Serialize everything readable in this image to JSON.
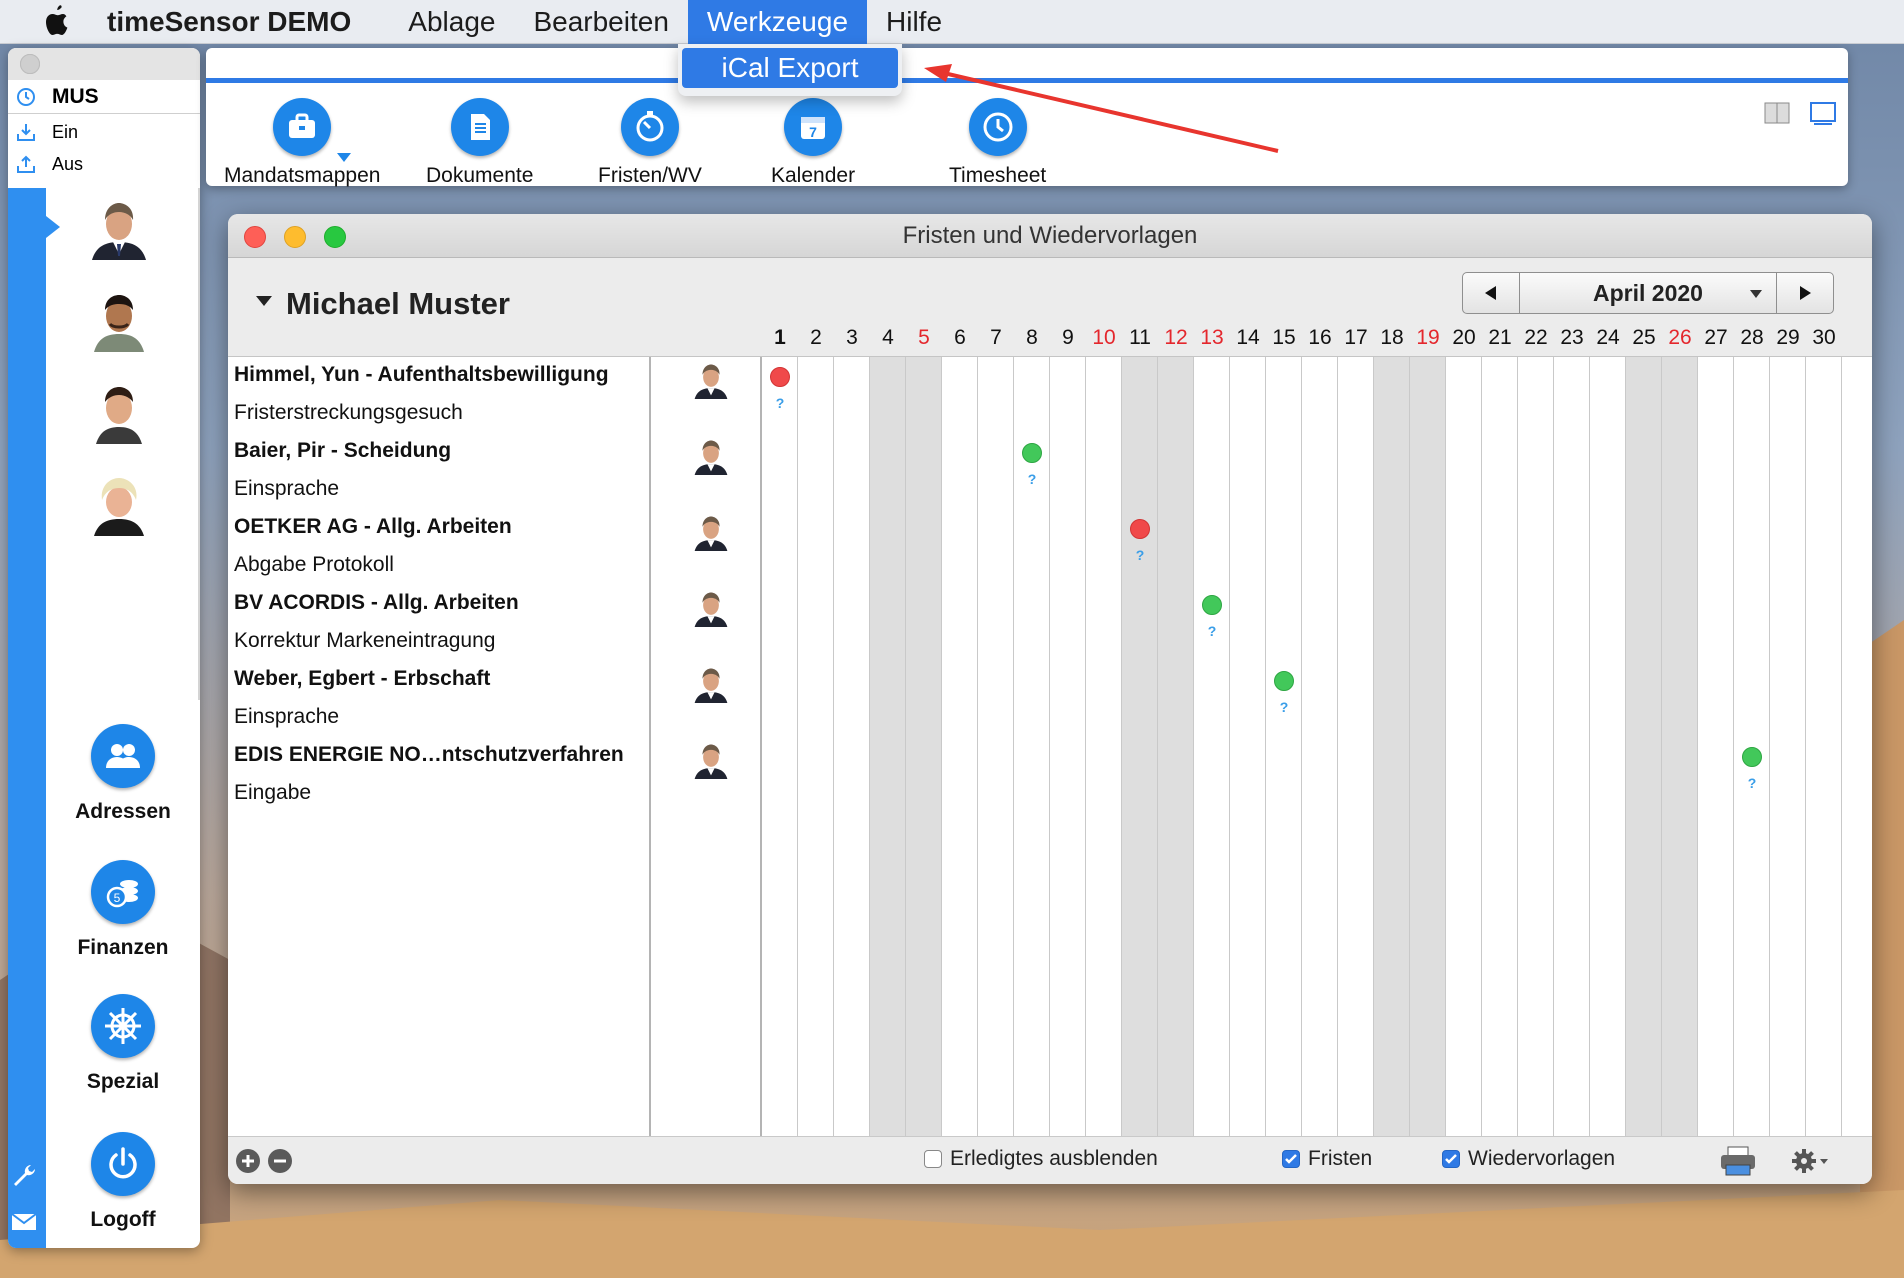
{
  "menubar": {
    "app_name": "timeSensor DEMO",
    "items": [
      "Ablage",
      "Bearbeiten",
      "Werkzeuge",
      "Hilfe"
    ],
    "active_item": "Werkzeuge",
    "dropdown_item": "iCal Export"
  },
  "palette": {
    "user_code": "MUS",
    "ein_label": "Ein",
    "aus_label": "Aus",
    "nav": [
      {
        "label": "Adressen",
        "icon": "people-icon"
      },
      {
        "label": "Finanzen",
        "icon": "coins-icon"
      },
      {
        "label": "Spezial",
        "icon": "helm-wheel-icon"
      },
      {
        "label": "Logoff",
        "icon": "power-icon"
      }
    ]
  },
  "toolbar": {
    "buttons": [
      {
        "label": "Mandatsmappen",
        "icon": "briefcase-icon"
      },
      {
        "label": "Dokumente",
        "icon": "document-icon"
      },
      {
        "label": "Fristen/WV",
        "icon": "stopwatch-icon"
      },
      {
        "label": "Kalender",
        "icon": "calendar-icon",
        "badge": "7"
      },
      {
        "label": "Timesheet",
        "icon": "clock-icon"
      }
    ]
  },
  "window": {
    "title": "Fristen und Wiedervorlagen",
    "person": "Michael Muster",
    "month": "April 2020",
    "days": [
      1,
      2,
      3,
      4,
      5,
      6,
      7,
      8,
      9,
      10,
      11,
      12,
      13,
      14,
      15,
      16,
      17,
      18,
      19,
      20,
      21,
      22,
      23,
      24,
      25,
      26,
      27,
      28,
      29,
      30
    ],
    "red_days": [
      5,
      10,
      12,
      13,
      19,
      26
    ],
    "weekend_days": [
      4,
      5,
      11,
      12,
      18,
      19,
      25,
      26
    ],
    "today": 1,
    "rows": [
      {
        "title": "Himmel, Yun - Aufenthaltsbewilligung",
        "subtitle": "Fristerstreckungsgesuch",
        "day": 1,
        "status": "red"
      },
      {
        "title": "Baier, Pir - Scheidung",
        "subtitle": "Einsprache",
        "day": 8,
        "status": "green"
      },
      {
        "title": "OETKER AG - Allg. Arbeiten",
        "subtitle": "Abgabe Protokoll",
        "day": 11,
        "status": "red"
      },
      {
        "title": "BV ACORDIS - Allg. Arbeiten",
        "subtitle": "Korrektur Markeneintragung",
        "day": 13,
        "status": "green"
      },
      {
        "title": "Weber, Egbert - Erbschaft",
        "subtitle": "Einsprache",
        "day": 15,
        "status": "green"
      },
      {
        "title": "EDIS ENERGIE NO…ntschutzverfahren",
        "subtitle": "Eingabe",
        "day": 28,
        "status": "green"
      }
    ],
    "qmark": "?",
    "footer": {
      "hide_done_label": "Erledigtes ausblenden",
      "hide_done_checked": false,
      "fristen_label": "Fristen",
      "fristen_checked": true,
      "wv_label": "Wiedervorlagen",
      "wv_checked": true
    }
  },
  "colors": {
    "accent": "#2f7ae5",
    "button_blue": "#1e86e8",
    "deadline_red": "#f0494a",
    "deadline_green": "#42c85a",
    "weekend_text": "#e4272d"
  }
}
